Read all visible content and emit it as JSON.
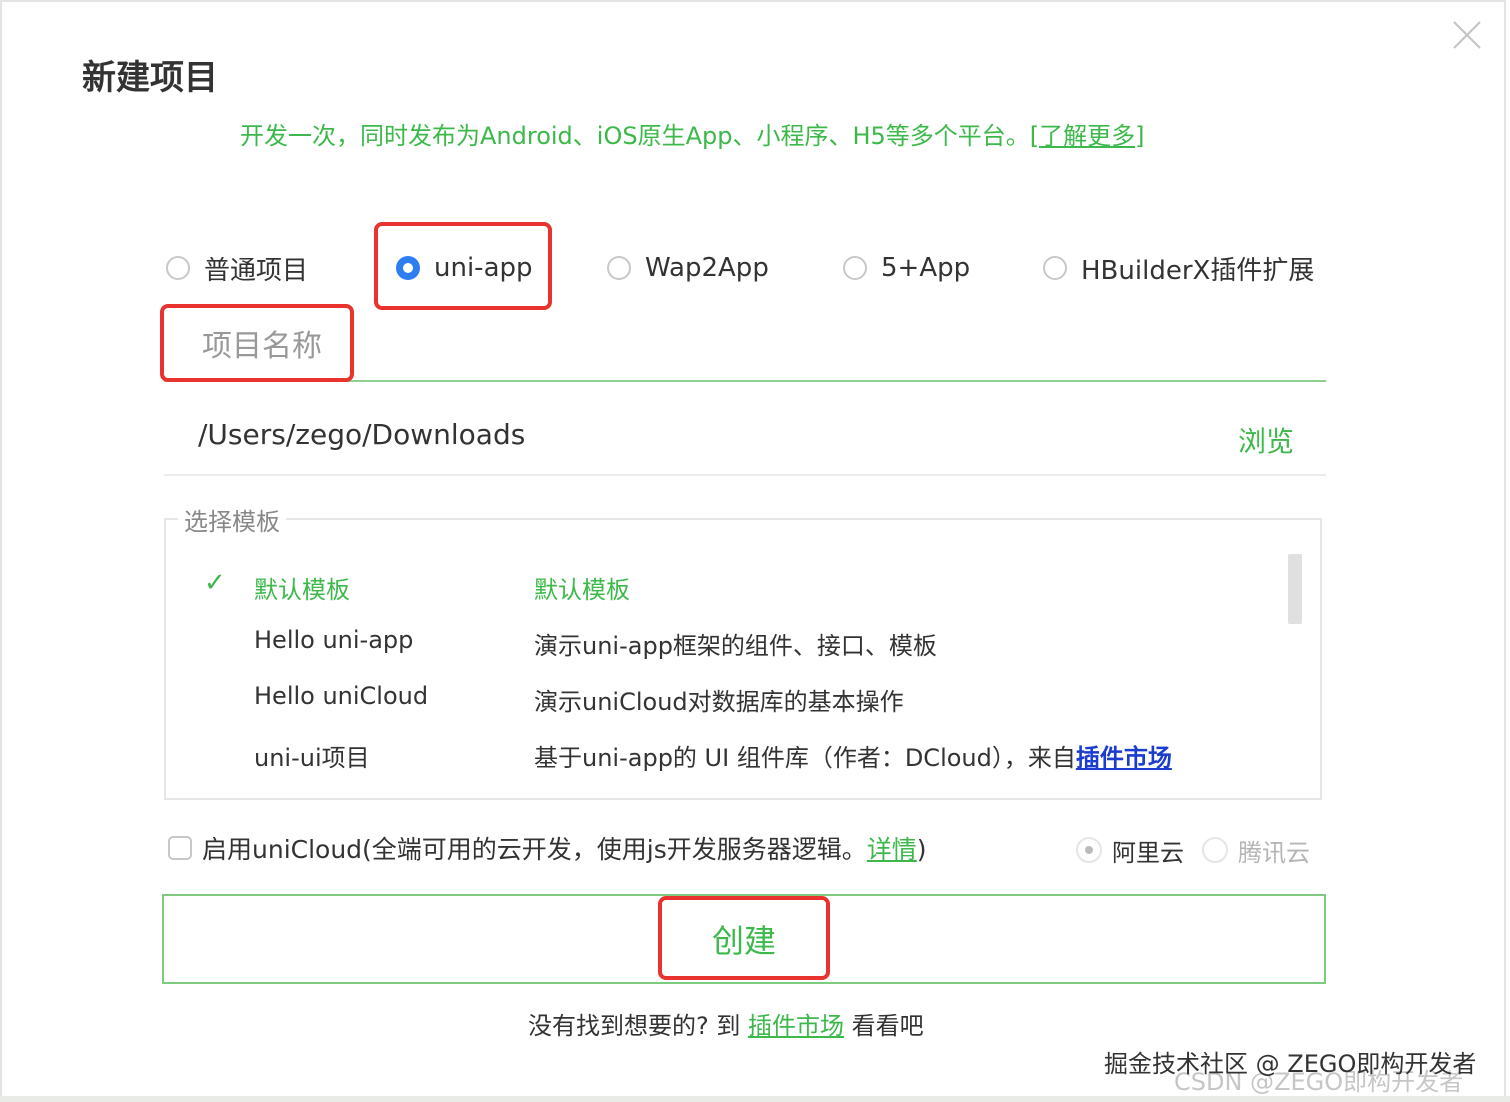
{
  "dialog": {
    "title": "新建项目",
    "subtitle": "开发一次，同时发布为Android、iOS原生App、小程序、H5等多个平台。",
    "learn_more": "[了解更多]"
  },
  "project_types": [
    {
      "label": "普通项目",
      "checked": false
    },
    {
      "label": "uni-app",
      "checked": true
    },
    {
      "label": "Wap2App",
      "checked": false
    },
    {
      "label": "5+App",
      "checked": false
    },
    {
      "label": "HBuilderX插件扩展",
      "checked": false
    }
  ],
  "project_name": {
    "placeholder": "项目名称",
    "value": ""
  },
  "location": {
    "path": "/Users/zego/Downloads",
    "browse_label": "浏览"
  },
  "templates": {
    "legend": "选择模板",
    "rows": [
      {
        "name": "默认模板",
        "desc": "默认模板",
        "selected": true
      },
      {
        "name": "Hello uni-app",
        "desc": "演示uni-app框架的组件、接口、模板",
        "selected": false
      },
      {
        "name": "Hello uniCloud",
        "desc": "演示uniCloud对数据库的基本操作",
        "selected": false
      },
      {
        "name": "uni-ui项目",
        "desc": "基于uni-app的 UI 组件库（作者：DCloud），来自",
        "link": "插件市场",
        "selected": false
      }
    ]
  },
  "unicloud": {
    "label": "启用uniCloud(全端可用的云开发，使用js开发服务器逻辑。",
    "details": "详情",
    "close": ")",
    "enabled": false,
    "providers": [
      {
        "label": "阿里云",
        "selected": true
      },
      {
        "label": "腾讯云",
        "selected": false
      }
    ]
  },
  "create_label": "创建",
  "footer": {
    "prefix": "没有找到想要的? 到",
    "link": "插件市场",
    "suffix": "看看吧"
  },
  "watermarks": {
    "line1": "掘金技术社区 @ ZEGO即构开发者",
    "line2": "CSDN @ZEGO即构开发者"
  },
  "colors": {
    "accent": "#3cb94a",
    "highlight_box": "#e8332e",
    "radio_selected": "#2f7ef0",
    "link_blue": "#1a3ccf"
  }
}
